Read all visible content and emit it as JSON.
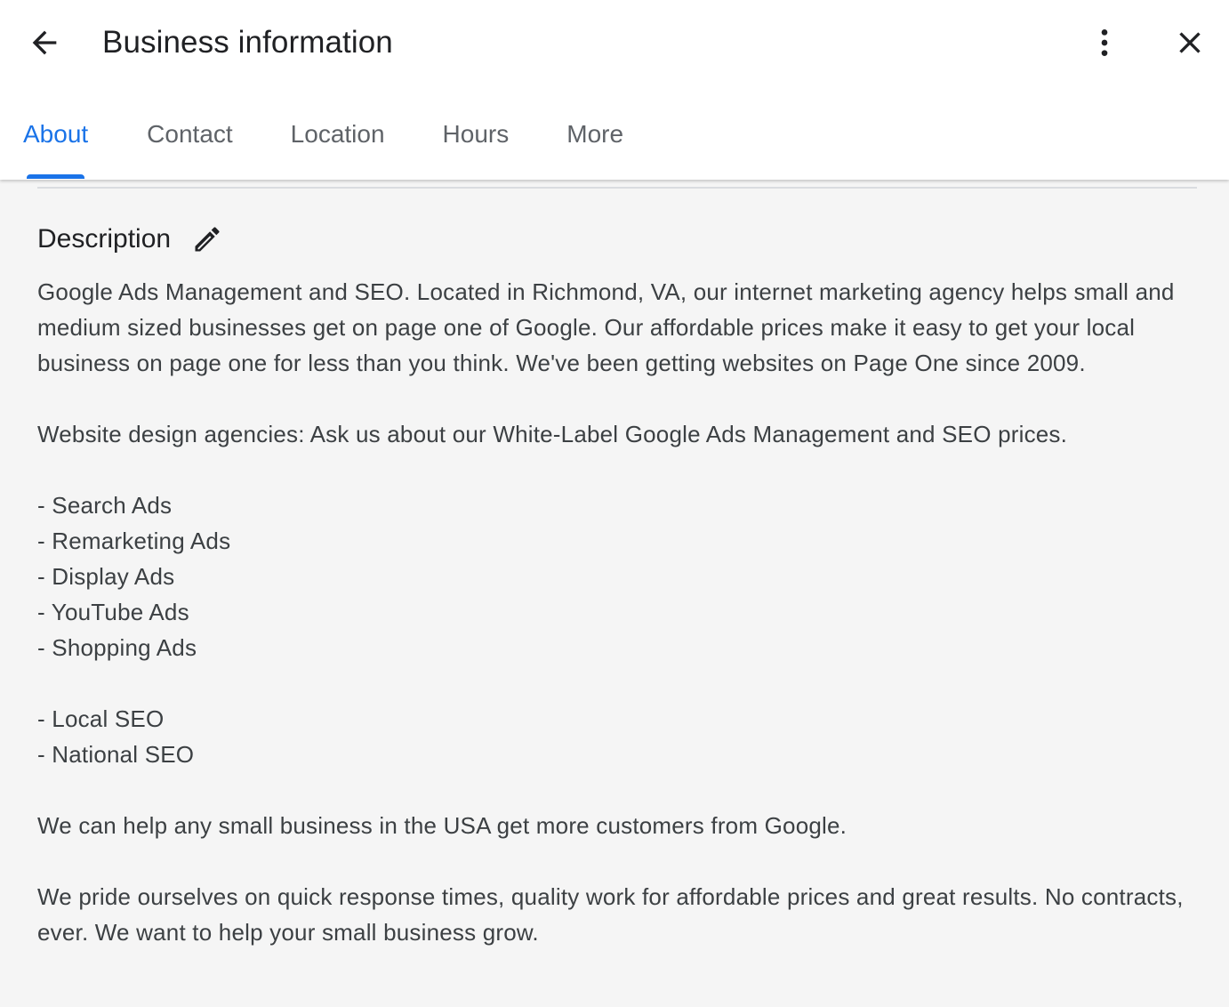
{
  "header": {
    "title": "Business information",
    "back_icon": "arrow-back-icon",
    "more_icon": "more-vert-icon",
    "close_icon": "close-icon"
  },
  "tabs": [
    {
      "label": "About",
      "active": true
    },
    {
      "label": "Contact",
      "active": false
    },
    {
      "label": "Location",
      "active": false
    },
    {
      "label": "Hours",
      "active": false
    },
    {
      "label": "More",
      "active": false
    }
  ],
  "description": {
    "heading": "Description",
    "edit_icon": "pencil-icon",
    "paragraph1": "Google Ads Management and SEO. Located in Richmond, VA, our internet marketing agency helps small and medium sized businesses get on page one of Google. Our affordable prices make it easy to get your local business on page one for less than you think. We've been getting websites on Page One since 2009.",
    "paragraph2": "Website design agencies: Ask us about our White-Label Google Ads Management and SEO prices.",
    "ads_list": [
      "- Search Ads",
      "- Remarketing Ads",
      "- Display Ads",
      "- YouTube Ads",
      "- Shopping Ads"
    ],
    "seo_list": [
      "- Local SEO",
      "- National SEO"
    ],
    "paragraph3": "We can help any small business in the USA get more customers from Google.",
    "paragraph4": "We pride ourselves on quick response times, quality work for affordable prices and great results. No contracts, ever. We want to help your small business grow."
  },
  "colors": {
    "accent": "#1a73e8",
    "text_primary": "#202124",
    "text_secondary": "#5f6368",
    "background": "#f5f5f5"
  }
}
